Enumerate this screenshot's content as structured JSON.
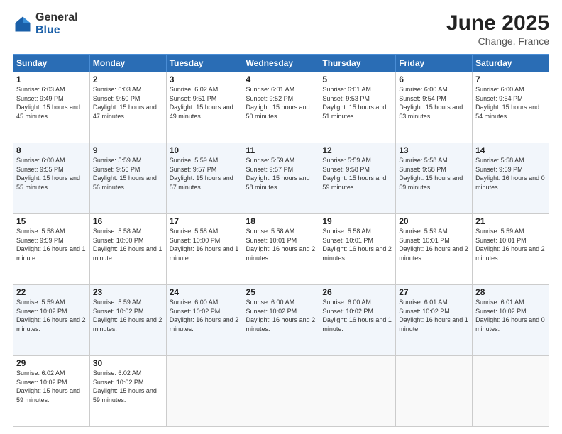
{
  "logo": {
    "general": "General",
    "blue": "Blue"
  },
  "header": {
    "month": "June 2025",
    "location": "Change, France"
  },
  "weekdays": [
    "Sunday",
    "Monday",
    "Tuesday",
    "Wednesday",
    "Thursday",
    "Friday",
    "Saturday"
  ],
  "weeks": [
    [
      {
        "day": "1",
        "sunrise": "6:03 AM",
        "sunset": "9:49 PM",
        "daylight": "15 hours and 45 minutes."
      },
      {
        "day": "2",
        "sunrise": "6:03 AM",
        "sunset": "9:50 PM",
        "daylight": "15 hours and 47 minutes."
      },
      {
        "day": "3",
        "sunrise": "6:02 AM",
        "sunset": "9:51 PM",
        "daylight": "15 hours and 49 minutes."
      },
      {
        "day": "4",
        "sunrise": "6:01 AM",
        "sunset": "9:52 PM",
        "daylight": "15 hours and 50 minutes."
      },
      {
        "day": "5",
        "sunrise": "6:01 AM",
        "sunset": "9:53 PM",
        "daylight": "15 hours and 51 minutes."
      },
      {
        "day": "6",
        "sunrise": "6:00 AM",
        "sunset": "9:54 PM",
        "daylight": "15 hours and 53 minutes."
      },
      {
        "day": "7",
        "sunrise": "6:00 AM",
        "sunset": "9:54 PM",
        "daylight": "15 hours and 54 minutes."
      }
    ],
    [
      {
        "day": "8",
        "sunrise": "6:00 AM",
        "sunset": "9:55 PM",
        "daylight": "15 hours and 55 minutes."
      },
      {
        "day": "9",
        "sunrise": "5:59 AM",
        "sunset": "9:56 PM",
        "daylight": "15 hours and 56 minutes."
      },
      {
        "day": "10",
        "sunrise": "5:59 AM",
        "sunset": "9:57 PM",
        "daylight": "15 hours and 57 minutes."
      },
      {
        "day": "11",
        "sunrise": "5:59 AM",
        "sunset": "9:57 PM",
        "daylight": "15 hours and 58 minutes."
      },
      {
        "day": "12",
        "sunrise": "5:59 AM",
        "sunset": "9:58 PM",
        "daylight": "15 hours and 59 minutes."
      },
      {
        "day": "13",
        "sunrise": "5:58 AM",
        "sunset": "9:58 PM",
        "daylight": "15 hours and 59 minutes."
      },
      {
        "day": "14",
        "sunrise": "5:58 AM",
        "sunset": "9:59 PM",
        "daylight": "16 hours and 0 minutes."
      }
    ],
    [
      {
        "day": "15",
        "sunrise": "5:58 AM",
        "sunset": "9:59 PM",
        "daylight": "16 hours and 1 minute."
      },
      {
        "day": "16",
        "sunrise": "5:58 AM",
        "sunset": "10:00 PM",
        "daylight": "16 hours and 1 minute."
      },
      {
        "day": "17",
        "sunrise": "5:58 AM",
        "sunset": "10:00 PM",
        "daylight": "16 hours and 1 minute."
      },
      {
        "day": "18",
        "sunrise": "5:58 AM",
        "sunset": "10:01 PM",
        "daylight": "16 hours and 2 minutes."
      },
      {
        "day": "19",
        "sunrise": "5:58 AM",
        "sunset": "10:01 PM",
        "daylight": "16 hours and 2 minutes."
      },
      {
        "day": "20",
        "sunrise": "5:59 AM",
        "sunset": "10:01 PM",
        "daylight": "16 hours and 2 minutes."
      },
      {
        "day": "21",
        "sunrise": "5:59 AM",
        "sunset": "10:01 PM",
        "daylight": "16 hours and 2 minutes."
      }
    ],
    [
      {
        "day": "22",
        "sunrise": "5:59 AM",
        "sunset": "10:02 PM",
        "daylight": "16 hours and 2 minutes."
      },
      {
        "day": "23",
        "sunrise": "5:59 AM",
        "sunset": "10:02 PM",
        "daylight": "16 hours and 2 minutes."
      },
      {
        "day": "24",
        "sunrise": "6:00 AM",
        "sunset": "10:02 PM",
        "daylight": "16 hours and 2 minutes."
      },
      {
        "day": "25",
        "sunrise": "6:00 AM",
        "sunset": "10:02 PM",
        "daylight": "16 hours and 2 minutes."
      },
      {
        "day": "26",
        "sunrise": "6:00 AM",
        "sunset": "10:02 PM",
        "daylight": "16 hours and 1 minute."
      },
      {
        "day": "27",
        "sunrise": "6:01 AM",
        "sunset": "10:02 PM",
        "daylight": "16 hours and 1 minute."
      },
      {
        "day": "28",
        "sunrise": "6:01 AM",
        "sunset": "10:02 PM",
        "daylight": "16 hours and 0 minutes."
      }
    ],
    [
      {
        "day": "29",
        "sunrise": "6:02 AM",
        "sunset": "10:02 PM",
        "daylight": "15 hours and 59 minutes."
      },
      {
        "day": "30",
        "sunrise": "6:02 AM",
        "sunset": "10:02 PM",
        "daylight": "15 hours and 59 minutes."
      },
      null,
      null,
      null,
      null,
      null
    ]
  ]
}
